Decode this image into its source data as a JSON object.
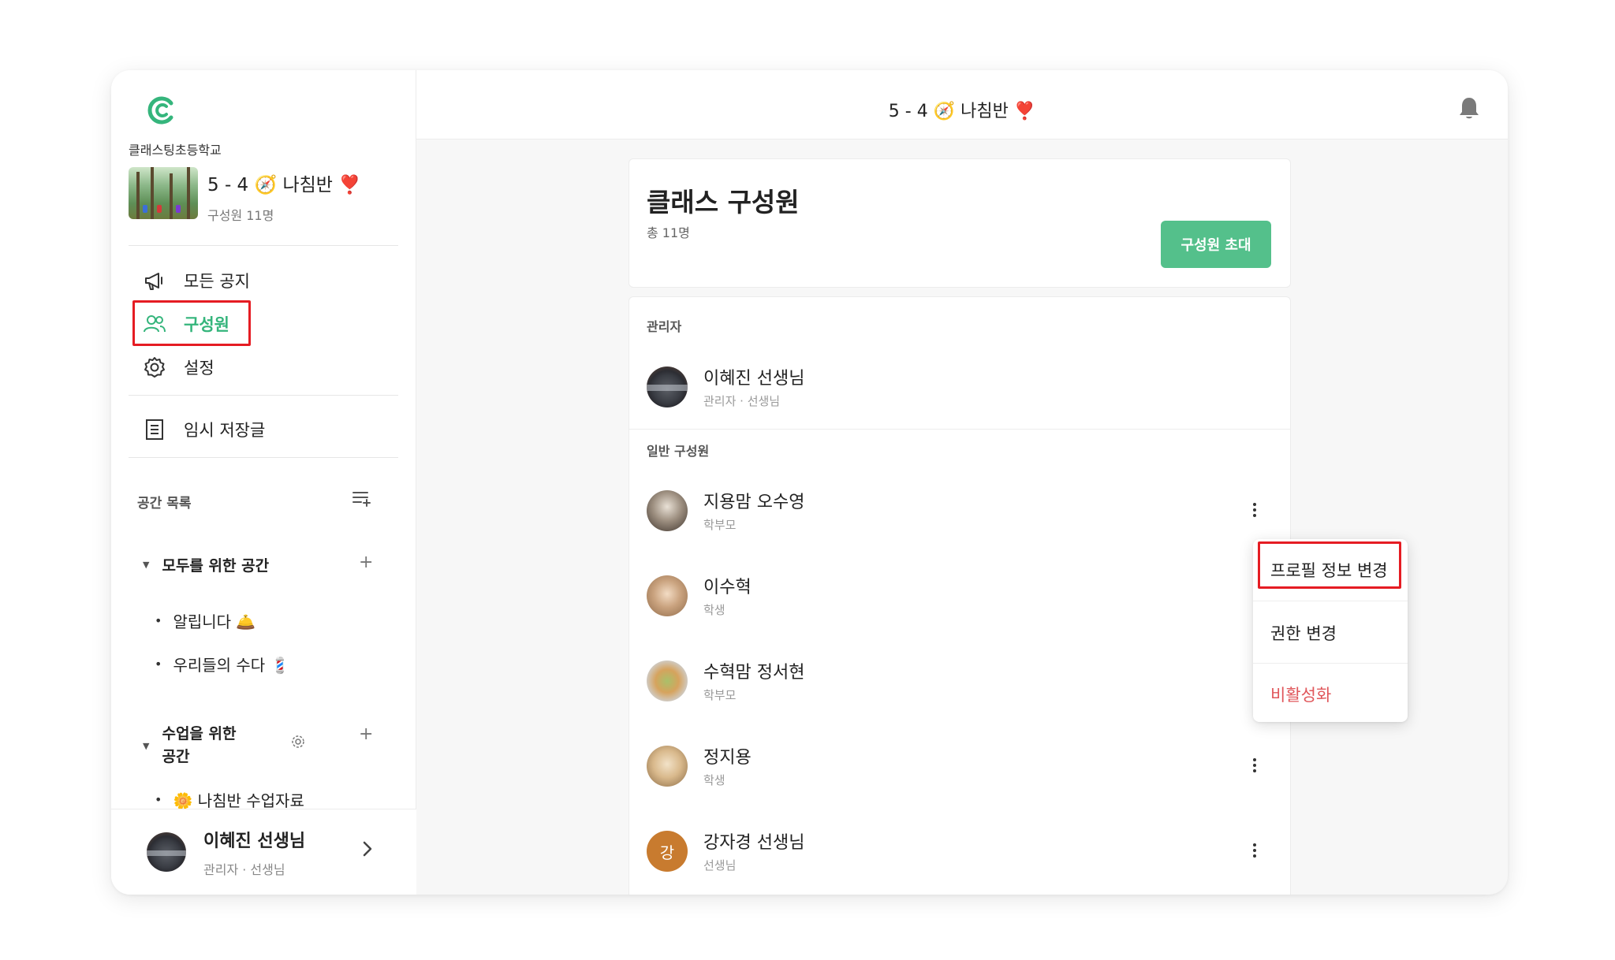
{
  "app": {
    "school": "클래스팅초등학교",
    "class_title": "5 - 4 🧭 나침반 ❣️",
    "member_count": "구성원 11명"
  },
  "sidebar": {
    "nav": [
      {
        "label": "모든 공지",
        "icon": "megaphone-icon"
      },
      {
        "label": "구성원",
        "icon": "people-icon",
        "active": true
      },
      {
        "label": "설정",
        "icon": "gear-icon"
      },
      {
        "label": "임시 저장글",
        "icon": "draft-document-icon"
      }
    ],
    "spaces_label": "공간 목록",
    "groups": [
      {
        "title": "모두를 위한 공간",
        "items": [
          "알립니다 🛎️",
          "우리들의 수다 💈"
        ]
      },
      {
        "title_line1": "수업을 위한",
        "title_line2": "공간",
        "items": [
          "🌼 나침반 수업자료"
        ]
      }
    ],
    "footer": {
      "name": "이혜진 선생님",
      "role": "관리자 · 선생님"
    }
  },
  "topbar": {
    "title": "5 - 4 🧭 나침반 ❣️"
  },
  "members_card": {
    "title": "클래스 구성원",
    "total": "총 11명",
    "invite_button": "구성원 초대"
  },
  "admins": {
    "label": "관리자",
    "list": [
      {
        "name": "이혜진 선생님",
        "role": "관리자 · 선생님"
      }
    ]
  },
  "general": {
    "label": "일반 구성원",
    "list": [
      {
        "name": "지용맘 오수영",
        "role": "학부모"
      },
      {
        "name": "이수혁",
        "role": "학생"
      },
      {
        "name": "수혁맘 정서현",
        "role": "학부모"
      },
      {
        "name": "정지용",
        "role": "학생"
      },
      {
        "name": "강자경 선생님",
        "role": "선생님",
        "initial": "강"
      }
    ]
  },
  "dropdown": {
    "items": [
      "프로필 정보 변경",
      "권한 변경",
      "비활성화"
    ]
  },
  "colors": {
    "accent": "#35b57c",
    "button": "#54c08b",
    "highlight": "#e51c23",
    "danger": "#e0575b"
  }
}
